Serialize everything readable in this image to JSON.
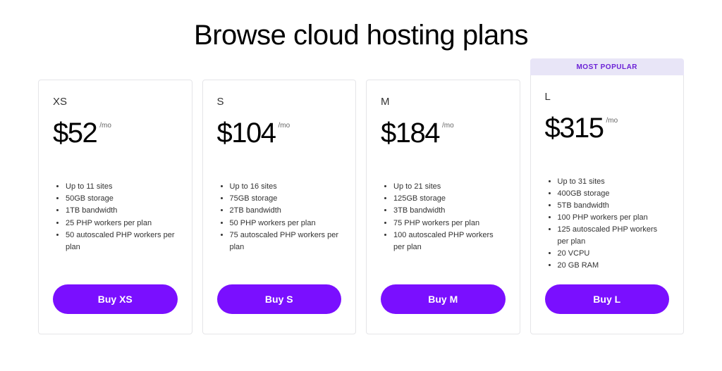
{
  "title": "Browse cloud hosting plans",
  "badge_label": "MOST POPULAR",
  "plans": [
    {
      "name": "XS",
      "price": "$52",
      "per": "/mo",
      "features": [
        "Up to 11 sites",
        "50GB storage",
        "1TB bandwidth",
        "25 PHP workers per plan",
        "50 autoscaled PHP workers per plan"
      ],
      "cta": "Buy XS",
      "popular": false
    },
    {
      "name": "S",
      "price": "$104",
      "per": "/mo",
      "features": [
        "Up to 16 sites",
        "75GB storage",
        "2TB bandwidth",
        "50 PHP workers per plan",
        "75 autoscaled PHP workers per plan"
      ],
      "cta": "Buy S",
      "popular": false
    },
    {
      "name": "M",
      "price": "$184",
      "per": "/mo",
      "features": [
        "Up to 21 sites",
        "125GB storage",
        "3TB bandwidth",
        "75 PHP workers per plan",
        "100 autoscaled PHP workers per plan"
      ],
      "cta": "Buy M",
      "popular": false
    },
    {
      "name": "L",
      "price": "$315",
      "per": "/mo",
      "features": [
        "Up to 31 sites",
        "400GB storage",
        "5TB bandwidth",
        "100 PHP workers per plan",
        "125 autoscaled PHP workers per plan",
        "20 VCPU",
        "20 GB RAM"
      ],
      "cta": "Buy L",
      "popular": true
    }
  ]
}
